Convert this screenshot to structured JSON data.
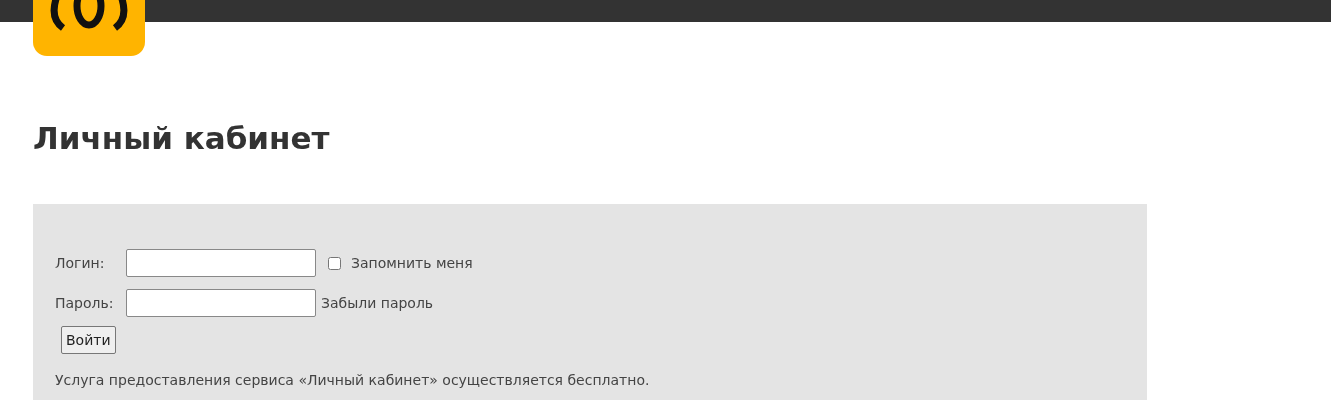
{
  "page_title": "Личный кабинет",
  "login_form": {
    "login_label": "Логин:",
    "remember": {
      "label": "Запомнить меня",
      "checked": false
    },
    "password_label": "Пароль:",
    "forgot_link": "Забыли пароль",
    "submit_button": "Войти"
  },
  "note": "Услуга предоставления сервиса «Личный кабинет» осуществляется бесплатно."
}
